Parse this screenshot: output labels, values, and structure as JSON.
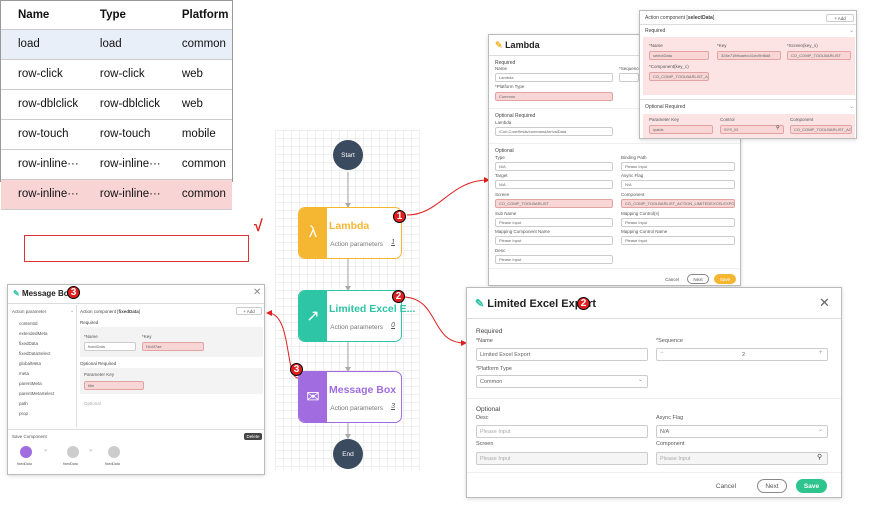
{
  "event_table": {
    "headers": [
      "Name",
      "Type",
      "Platform"
    ],
    "rows": [
      [
        "load",
        "load",
        "common"
      ],
      [
        "row-click",
        "row-click",
        "web"
      ],
      [
        "row-dblclick",
        "row-dblclick",
        "web"
      ],
      [
        "row-touch",
        "row-touch",
        "mobile"
      ],
      [
        "row-inline···",
        "row-inline···",
        "common"
      ],
      [
        "row-inline···",
        "row-inline···",
        "common"
      ]
    ],
    "check_mark": "√"
  },
  "flow": {
    "start": "Start",
    "end": "End",
    "nodes": [
      {
        "name": "Lambda",
        "params": "Action parameters",
        "count": "1"
      },
      {
        "name": "Limited Excel E...",
        "params": "Action parameters",
        "count": "0"
      },
      {
        "name": "Message Box",
        "params": "Action parameters",
        "count": "3"
      }
    ],
    "colors": {
      "lambda": "#f5b731",
      "excel": "#2ec4a6",
      "message": "#a06ce0"
    },
    "badges": [
      "1",
      "2",
      "3"
    ]
  },
  "lambda_dialog": {
    "title": "Lambda",
    "required": "Required",
    "name_label": "Name",
    "name_value": "Lambda",
    "sequence_label": "*Sequence",
    "platform_label": "*Platform Type",
    "platform_value": "Common",
    "optional_required": "Optional Required",
    "lambda_label": "Lambda",
    "lambda_value": "/Cub.Core/fields/commandArrivalData",
    "optional": "Optional",
    "type_label": "Type",
    "type_value": "N/A",
    "binding_label": "Binding Path",
    "binding_value": "Please Input",
    "target_label": "Target",
    "target_value": "N/A",
    "async_label": "Async Flag",
    "async_value": "N/A",
    "screen_label": "Screen",
    "screen_value": "CO_COMP_TOOLBARLIST",
    "component_label": "Component",
    "component_value": "CO_COMP_TOOLBARLIST_ACTION_LIMITEDEXCELEXPORT_SHAPE",
    "subname_label": "Sub Name",
    "subname_value": "Please Input",
    "mapcontrols_label": "Mapping Control(s)",
    "mapcontrols_value": "Please Input",
    "mapcompname_label": "Mapping Component Name",
    "mapcompname_value": "Please Input",
    "mapcontrolname_label": "Mapping Control Name",
    "mapcontrolname_value": "Please Input",
    "desc_label": "Desc",
    "desc_value": "Please Input",
    "cancel": "Cancel",
    "next": "Next",
    "save": "Save"
  },
  "select_dialog": {
    "title_prefix": "Action component [",
    "title_bold": "selectData",
    "title_suffix": "]",
    "add": "+ Add",
    "required": "Required",
    "name_label": "*Name",
    "name_value": "selectData",
    "key_label": "*Key",
    "key_value": "326e71fbfcaebc41ec9bf6d8",
    "screenkey_label": "*Screen(key_s)",
    "screenkey_value": "CO_COMP_TOOLBARLIST",
    "compkey_label": "*Component(key_c)",
    "compkey_value": "CO_COMP_TOOLBARLIST_ACT",
    "optional_required": "Optional Required",
    "param_key": "Parameter Key",
    "control": "Control",
    "component": "Component",
    "param_value": "ipaids",
    "control_value": "SYS_ID",
    "component_value": "CO_COMP_TOOLBARLIST_AC"
  },
  "message_dialog": {
    "title": "Message Box",
    "sidebar_header": "Action parameter",
    "sidebar_items": [
      "contentId",
      "extendedMeta",
      "fixedData",
      "fixedDataSelect",
      "globalMeta",
      "meta",
      "parentMeta",
      "parentMetaSelect",
      "path",
      "prop"
    ],
    "comp_title_prefix": "Action component [",
    "comp_title_bold": "fixedData",
    "comp_title_suffix": "]",
    "add": "+ Add",
    "required": "Required",
    "name_label": "*Name",
    "name_value": "fixedData",
    "key_label": "*Key",
    "key_value": "f1b4f7ae",
    "optional_required": "Optional Required",
    "param_key": "Parameter Key",
    "param_value": "title",
    "optional": "Optional",
    "save_component": "Save Component",
    "delete": "Delete",
    "chain": [
      "fixedData",
      "fixedData",
      "fixedData"
    ]
  },
  "excel_dialog": {
    "title": "Limited Excel Export",
    "required": "Required",
    "name_label": "*Name",
    "name_value": "Limited Excel Export",
    "sequence_label": "*Sequence",
    "sequence_value": "2",
    "platform_label": "*Platform Type",
    "platform_value": "Common",
    "optional": "Optional",
    "desc_label": "Desc",
    "desc_value": "Please Input",
    "async_label": "Async Flag",
    "async_value": "N/A",
    "screen_label": "Screen",
    "screen_value": "Please Input",
    "component_label": "Component",
    "component_value": "Please Input",
    "cancel": "Cancel",
    "next": "Next",
    "save": "Save"
  }
}
